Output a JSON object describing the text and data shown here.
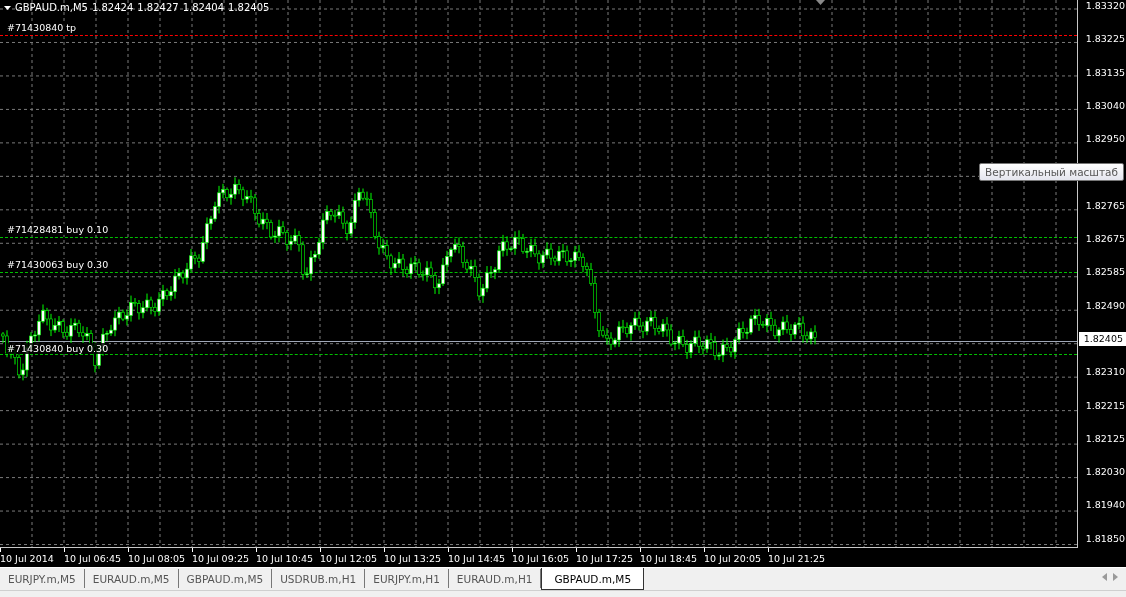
{
  "chart_header": {
    "symbol": "GBPAUD.m,M5",
    "quotes": [
      "1.82424",
      "1.82427",
      "1.82404",
      "1.82405"
    ]
  },
  "orders": [
    {
      "label": "#71430840 tp",
      "color": "#ff0000"
    },
    {
      "label": "#71428481 buy 0.10",
      "color": "#00c000"
    },
    {
      "label": "#71430063 buy 0.30",
      "color": "#00c000"
    },
    {
      "label": "#71430840 buy 0.30",
      "color": "#00c000"
    }
  ],
  "price_axis": [
    {
      "kind": "tick",
      "label": "1.83320"
    },
    {
      "kind": "tick",
      "label": "1.83225"
    },
    {
      "kind": "tick",
      "label": "1.83135"
    },
    {
      "kind": "tick",
      "label": "1.83040"
    },
    {
      "kind": "tick",
      "label": "1.82950"
    },
    {
      "kind": "tooltip",
      "label": "Вертикальный масштаб"
    },
    {
      "kind": "tick",
      "label": "1.82765"
    },
    {
      "kind": "tick",
      "label": "1.82675"
    },
    {
      "kind": "tick",
      "label": "1.82585"
    },
    {
      "kind": "tick",
      "label": "1.82490"
    },
    {
      "kind": "current",
      "label": "1.82405"
    },
    {
      "kind": "tick",
      "label": "1.82310"
    },
    {
      "kind": "tick",
      "label": "1.82215"
    },
    {
      "kind": "tick",
      "label": "1.82125"
    },
    {
      "kind": "tick",
      "label": "1.82030"
    },
    {
      "kind": "tick",
      "label": "1.81940"
    },
    {
      "kind": "tick",
      "label": "1.81850"
    }
  ],
  "time_axis": [
    "10 Jul 2014",
    "10 Jul 06:45",
    "10 Jul 08:05",
    "10 Jul 09:25",
    "10 Jul 10:45",
    "10 Jul 12:05",
    "10 Jul 13:25",
    "10 Jul 14:45",
    "10 Jul 16:05",
    "10 Jul 17:25",
    "10 Jul 18:45",
    "10 Jul 20:05",
    "10 Jul 21:25"
  ],
  "tabs": [
    {
      "label": "EURJPY.m,M5",
      "selected": false
    },
    {
      "label": "EURAUD.m,M5",
      "selected": false
    },
    {
      "label": "GBPAUD.m,M5",
      "selected": false
    },
    {
      "label": "USDRUB.m,H1",
      "selected": false
    },
    {
      "label": "EURJPY.m,H1",
      "selected": false
    },
    {
      "label": "EURAUD.m,H1",
      "selected": false
    },
    {
      "label": "GBPAUD.m,M5",
      "selected": true
    }
  ]
}
